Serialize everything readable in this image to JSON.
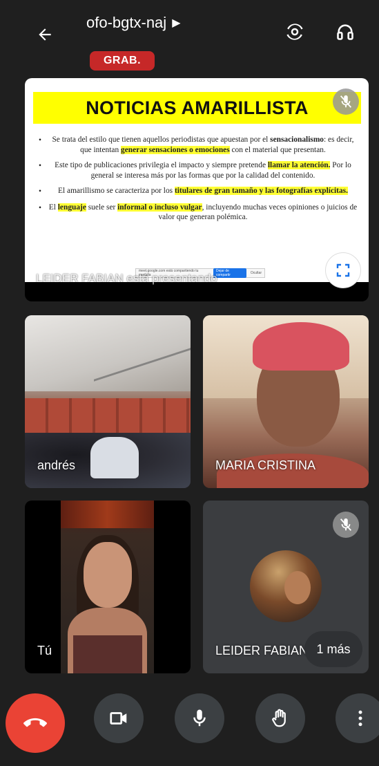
{
  "header": {
    "meeting_code": "ofo-bgtx-naj",
    "recording_badge": "GRAB.",
    "back_icon": "arrow-back-icon",
    "switch_camera_icon": "switch-camera-icon",
    "audio_output_icon": "headphones-icon"
  },
  "presentation": {
    "slide_title": "NOTICIAS AMARILLISTA",
    "bullets": [
      {
        "parts": [
          {
            "t": "Se trata del estilo que tienen aquellos periodistas que apuestan por el ",
            "s": ""
          },
          {
            "t": "sensacionalismo",
            "s": "b"
          },
          {
            "t": ": es decir, que intentan ",
            "s": ""
          },
          {
            "t": "generar sensaciones o emociones",
            "s": "hl"
          },
          {
            "t": " con el material que presentan.",
            "s": ""
          }
        ]
      },
      {
        "parts": [
          {
            "t": "Este tipo de publicaciones privilegia el impacto y siempre pretende ",
            "s": ""
          },
          {
            "t": "llamar la atención.",
            "s": "hl"
          },
          {
            "t": " Por lo general se interesa más por las formas que por la calidad del contenido.",
            "s": ""
          }
        ]
      },
      {
        "parts": [
          {
            "t": "El amarillismo se caracteriza por los ",
            "s": ""
          },
          {
            "t": "titulares de gran tamaño y las fotografías explícitas.",
            "s": "hl"
          }
        ]
      },
      {
        "parts": [
          {
            "t": "El ",
            "s": ""
          },
          {
            "t": "lenguaje",
            "s": "hl"
          },
          {
            "t": " suele ser ",
            "s": ""
          },
          {
            "t": "informal o incluso vulgar",
            "s": "hl"
          },
          {
            "t": ", incluyendo muchas veces opiniones o juicios de valor que generan polémica.",
            "s": ""
          }
        ]
      }
    ],
    "share_bar_text": "meet.google.com está compartiendo tu pantalla",
    "share_bar_stop": "Dejar de compartir",
    "share_bar_hide": "Ocultar",
    "presenter_label": "LEIDER FABIAN está presentando"
  },
  "participants": [
    {
      "name": "andrés"
    },
    {
      "name": "MARIA CRISTINA"
    },
    {
      "name": "Tú"
    },
    {
      "name": "LEIDER FABIAN"
    }
  ],
  "more_participants": "1 más",
  "controls": {
    "end_call_icon": "end-call-icon",
    "camera_icon": "video-camera-icon",
    "mic_icon": "microphone-icon",
    "hand_icon": "raise-hand-icon",
    "more_icon": "more-vertical-icon"
  },
  "colors": {
    "end_call": "#ea4335",
    "record_badge": "#c62828",
    "slide_title_bg": "#ffff00",
    "control_bg": "#3c4043"
  }
}
